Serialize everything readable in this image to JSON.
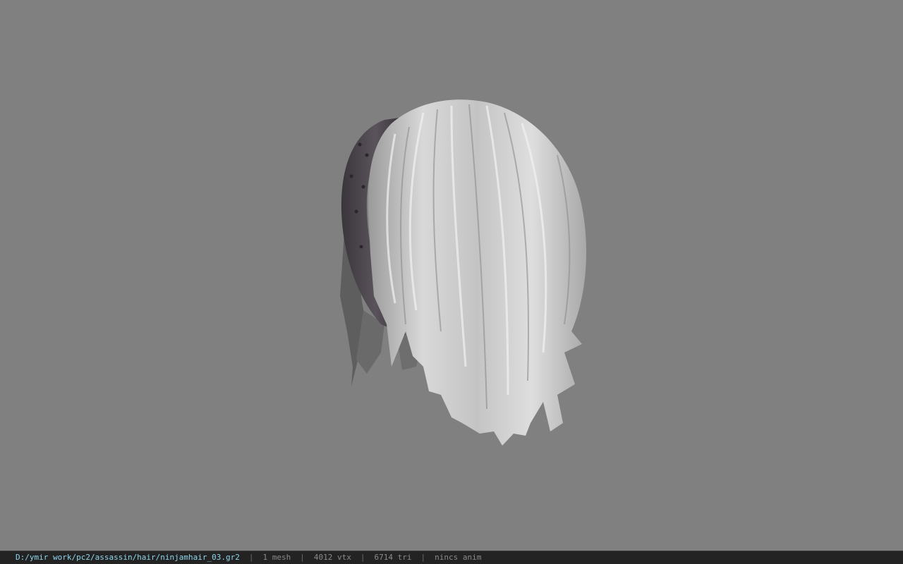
{
  "viewport": {
    "background_color": "#808080",
    "model_icon": "hair-mesh-model"
  },
  "statusbar": {
    "file_path": "D:/ymir work/pc2/assassin/hair/ninjamhair_03.gr2",
    "separator": "|",
    "mesh_count": "1 mesh",
    "vertex_count": "4012 vtx",
    "triangle_count": "6714 tri",
    "anim_status": "nincs anim",
    "path_color": "#8fd6ec"
  }
}
